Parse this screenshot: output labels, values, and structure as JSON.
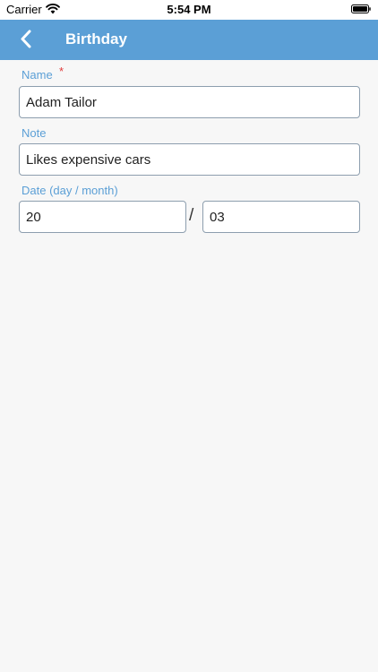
{
  "status": {
    "carrier": "Carrier",
    "time": "5:54 PM"
  },
  "nav": {
    "title": "Birthday",
    "back_icon": "chevron-left-icon"
  },
  "form": {
    "name_label": "Name",
    "name_required_mark": "*",
    "name_value": "Adam Tailor",
    "note_label": "Note",
    "note_value": "Likes expensive cars",
    "date_label": "Date (day / month)",
    "day_value": "20",
    "separator": "/",
    "month_value": "03"
  },
  "colors": {
    "nav_bar": "#5b9fd6",
    "label": "#5b9fd6",
    "required": "#e03b3b",
    "background": "#f7f7f7"
  }
}
